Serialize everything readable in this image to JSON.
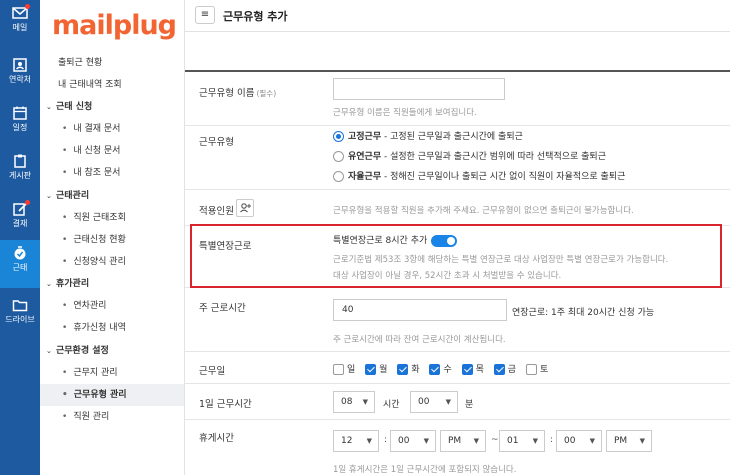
{
  "rail": [
    {
      "label": "메일",
      "icon": "mail-icon",
      "dot": true
    },
    {
      "label": "연락처",
      "icon": "contact-icon",
      "dot": false
    },
    {
      "label": "일정",
      "icon": "calendar-icon",
      "dot": false
    },
    {
      "label": "게시판",
      "icon": "board-icon",
      "dot": false
    },
    {
      "label": "결재",
      "icon": "approval-icon",
      "dot": true
    },
    {
      "label": "근태",
      "icon": "attendance-icon",
      "dot": false,
      "active": true
    },
    {
      "label": "드라이브",
      "icon": "drive-icon",
      "dot": false
    }
  ],
  "logo": "mailplug",
  "nav": {
    "attendance_status": "출퇴근 현황",
    "my_history": "내 근태내역 조회",
    "request_group": "근태 신청",
    "my_approval_doc": "내 결재 문서",
    "my_request_doc": "내 신청 문서",
    "my_reference_doc": "내 참조 문서",
    "manage_group": "근태관리",
    "staff_lookup": "직원 근태조회",
    "request_status": "근태신청 현황",
    "form_manage": "신청양식 관리",
    "leave_group": "휴가관리",
    "annual_manage": "연차관리",
    "leave_history": "휴가신청 내역",
    "settings_group": "근무환경 설정",
    "workplace_manage": "근무지 관리",
    "worktype_manage": "근무유형 관리",
    "staff_manage": "직원 관리"
  },
  "header": {
    "title": "근무유형 추가",
    "menu_glyph": "≡"
  },
  "form": {
    "name_label": "근무유형 이름",
    "name_required": "(필수)",
    "name_value": "",
    "name_help": "근무유형 이름은 직원들에게 보여집니다.",
    "type_label": "근무유형",
    "types": [
      {
        "bold": "고정근무",
        "desc": " - 고정된 근무일과 출근시간에 출퇴근",
        "selected": true
      },
      {
        "bold": "유연근무",
        "desc": " - 설정한 근무일과 출근시간 범위에 따라 선택적으로 출퇴근",
        "selected": false
      },
      {
        "bold": "자율근무",
        "desc": " - 정해진 근무일이나 출퇴근 시간 없이 직원이 자율적으로 출퇴근",
        "selected": false
      }
    ],
    "members_label": "적용인원",
    "members_help": "근무유형을 적용할 직원을 추가해 주세요. 근무유형이 없으면 출퇴근이 불가능합니다.",
    "special_label": "특별연장근로",
    "special_toggle_label": "특별연장근로 8시간 추가",
    "special_toggle_on": true,
    "special_help_1": "근로기준법 제53조 3항에 해당하는 특별 연장근로 대상 사업장만 특별 연장근로가 가능합니다.",
    "special_help_2": "대상 사업장이 아닐 경우, 52시간 초과 시 처벌받을 수 있습니다.",
    "weekly_label": "주 근로시간",
    "weekly_value": "40",
    "weekly_overtime": "연장근로: 1주 최대 20시간 신청 가능",
    "weekly_help": "주 근로시간에 따라 잔여 근로시간이 계산됩니다.",
    "days_label": "근무일",
    "days": [
      {
        "label": "일",
        "checked": false
      },
      {
        "label": "월",
        "checked": true
      },
      {
        "label": "화",
        "checked": true
      },
      {
        "label": "수",
        "checked": true
      },
      {
        "label": "목",
        "checked": true
      },
      {
        "label": "금",
        "checked": true
      },
      {
        "label": "토",
        "checked": false
      }
    ],
    "daily_label": "1일 근무시간",
    "daily_hours": "08",
    "daily_hours_unit": "시간",
    "daily_minutes": "00",
    "daily_minutes_unit": "분",
    "break_label": "휴게시간",
    "break_start_h": "12",
    "break_start_m": "00",
    "break_start_ampm": "PM",
    "break_tilde": "~",
    "break_end_h": "01",
    "break_end_m": "00",
    "break_end_ampm": "PM",
    "break_colon": ":",
    "break_help": "1일 휴게시간은 1일 근무시간에 포함되지 않습니다."
  }
}
